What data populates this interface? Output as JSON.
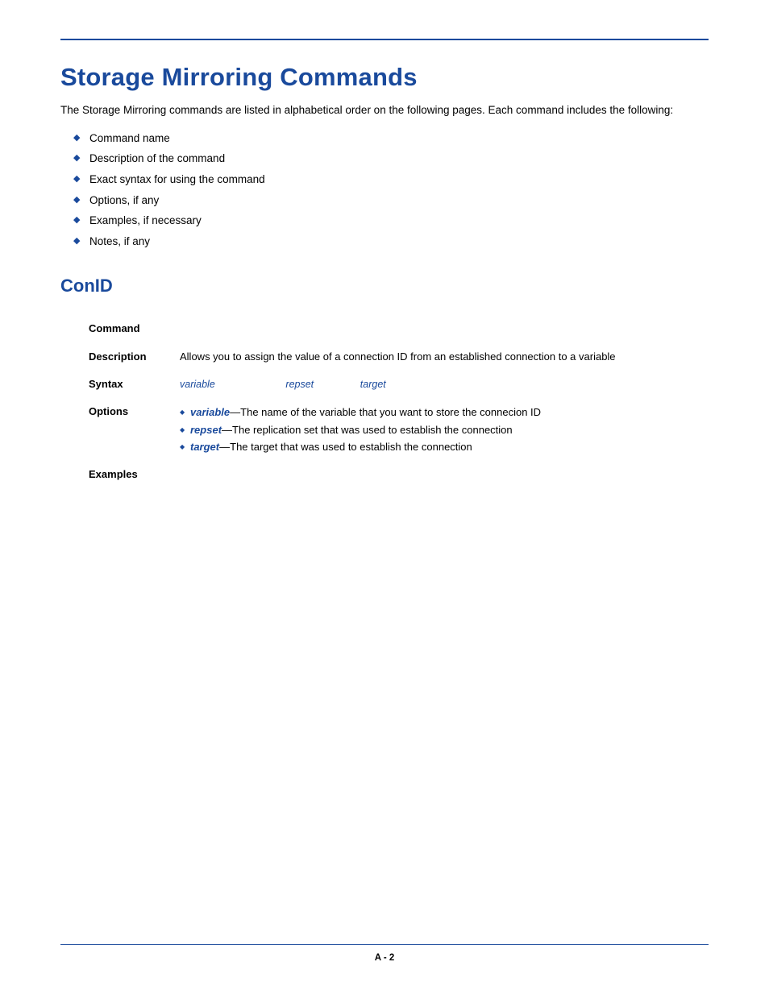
{
  "title": "Storage Mirroring Commands",
  "intro": "The Storage Mirroring commands are listed in alphabetical order on the following pages. Each command includes the following:",
  "bullets": [
    "Command name",
    "Description of the command",
    "Exact syntax for using the command",
    "Options, if any",
    "Examples, if necessary",
    "Notes, if any"
  ],
  "section_heading": "ConID",
  "labels": {
    "command": "Command",
    "description": "Description",
    "syntax": "Syntax",
    "options": "Options",
    "examples": "Examples"
  },
  "description_text": "Allows you to assign the value of a connection ID from an established connection to a variable",
  "syntax": {
    "a": "variable",
    "b": "repset",
    "c": "target"
  },
  "options": [
    {
      "name": "variable",
      "desc": "—The name of the variable that you want to store the connecion ID"
    },
    {
      "name": "repset",
      "desc": "—The replication set that was used to establish the connection"
    },
    {
      "name": "target",
      "desc": "—The target that was used to establish the connection"
    }
  ],
  "page_number": "A - 2"
}
